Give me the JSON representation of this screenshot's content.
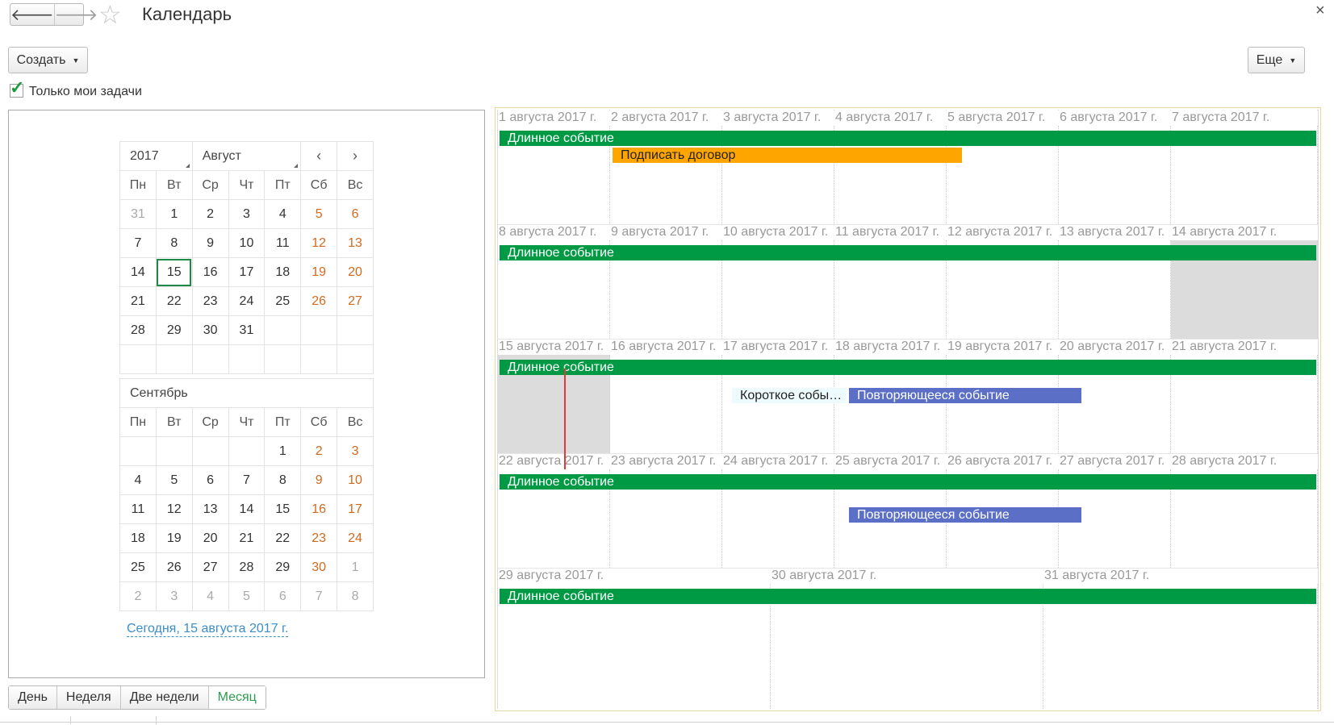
{
  "window": {
    "title": "Календарь",
    "close": "×",
    "back": "🡐",
    "forward": "🡒",
    "favorite": "☆"
  },
  "toolbar": {
    "create_label": "Создать",
    "more_label": "Еще"
  },
  "filter": {
    "only_my_tasks_label": "Только мои задачи",
    "only_my_tasks_checked": true,
    "check_glyph": "✓"
  },
  "mini_calendar": {
    "year": "2017",
    "month": "Август",
    "prev": "‹",
    "next": "›",
    "weekdays": [
      "Пн",
      "Вт",
      "Ср",
      "Чт",
      "Пт",
      "Сб",
      "Вс"
    ],
    "august_weeks": [
      [
        "31",
        "1",
        "2",
        "3",
        "4",
        "5",
        "6"
      ],
      [
        "7",
        "8",
        "9",
        "10",
        "11",
        "12",
        "13"
      ],
      [
        "14",
        "15",
        "16",
        "17",
        "18",
        "19",
        "20"
      ],
      [
        "21",
        "22",
        "23",
        "24",
        "25",
        "26",
        "27"
      ],
      [
        "28",
        "29",
        "30",
        "31",
        "",
        "",
        ""
      ],
      [
        "",
        "",
        "",
        "",
        "",
        "",
        ""
      ]
    ],
    "selected_day": "15",
    "next_month": "Сентябрь",
    "september_weeks": [
      [
        "",
        "",
        "",
        "",
        "1",
        "2",
        "3"
      ],
      [
        "4",
        "5",
        "6",
        "7",
        "8",
        "9",
        "10"
      ],
      [
        "11",
        "12",
        "13",
        "14",
        "15",
        "16",
        "17"
      ],
      [
        "18",
        "19",
        "20",
        "21",
        "22",
        "23",
        "24"
      ],
      [
        "25",
        "26",
        "27",
        "28",
        "29",
        "30",
        "1"
      ],
      [
        "2",
        "3",
        "4",
        "5",
        "6",
        "7",
        "8"
      ]
    ],
    "today_link": "Сегодня, 15 августа 2017 г."
  },
  "view_modes": [
    {
      "label": "День",
      "active": false
    },
    {
      "label": "Неделя",
      "active": false
    },
    {
      "label": "Две недели",
      "active": false
    },
    {
      "label": "Месяц",
      "active": true
    }
  ],
  "month_view": {
    "weeks": [
      {
        "days": [
          "1 августа 2017 г.",
          "2 августа 2017 г.",
          "3 августа 2017 г.",
          "4 августа 2017 г.",
          "5 августа 2017 г.",
          "6 августа 2017 г.",
          "7 августа 2017 г."
        ]
      },
      {
        "days": [
          "8 августа 2017 г.",
          "9 августа 2017 г.",
          "10 августа 2017 г.",
          "11 августа 2017 г.",
          "12 августа 2017 г.",
          "13 августа 2017 г.",
          "14 августа 2017 г."
        ]
      },
      {
        "days": [
          "15 августа 2017 г.",
          "16 августа 2017 г.",
          "17 августа 2017 г.",
          "18 августа 2017 г.",
          "19 августа 2017 г.",
          "20 августа 2017 г.",
          "21 августа 2017 г."
        ]
      },
      {
        "days": [
          "22 августа 2017 г.",
          "23 августа 2017 г.",
          "24 августа 2017 г.",
          "25 августа 2017 г.",
          "26 августа 2017 г.",
          "27 августа 2017 г.",
          "28 августа 2017 г."
        ]
      },
      {
        "days": [
          "29 августа 2017 г.",
          "30 августа 2017 г.",
          "31 августа 2017 г."
        ]
      }
    ],
    "events": {
      "long_event": "Длинное событие",
      "sign_contract": "Подписать договор",
      "short_event": "Короткое событие",
      "recurring_event": "Повторяющееся событие"
    },
    "colors": {
      "green": "#009a44",
      "orange": "#ffa500",
      "blue": "#5b6fc7",
      "now_line": "#e53935"
    }
  }
}
